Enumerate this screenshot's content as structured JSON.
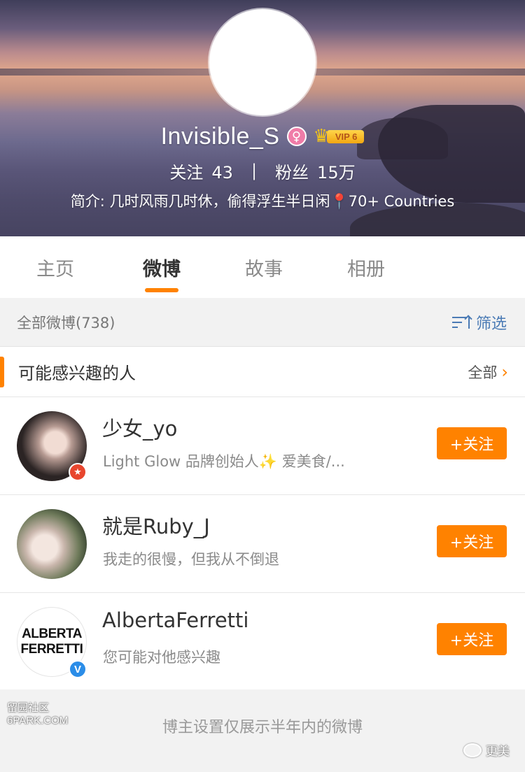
{
  "profile": {
    "username": "Invisible_S",
    "gender_icon": "female-icon",
    "vip_label": "VIP 6",
    "following_label": "关注",
    "following_count": "43",
    "separator": "|",
    "followers_label": "粉丝",
    "followers_count": "15万",
    "bio_text": "简介: 几时风雨几时休，偷得浮生半日闲",
    "bio_extra": "70+ Countries"
  },
  "tabs": [
    {
      "label": "主页",
      "active": false
    },
    {
      "label": "微博",
      "active": true
    },
    {
      "label": "故事",
      "active": false
    },
    {
      "label": "相册",
      "active": false
    }
  ],
  "filter_bar": {
    "count_label": "全部微博(738)",
    "filter_label": "筛选"
  },
  "suggestions": {
    "title": "可能感兴趣的人",
    "see_all_label": "全部",
    "users": [
      {
        "name": "少女_yo",
        "desc": "Light Glow 品牌创始人✨ 爱美食/...",
        "button": "+关注",
        "badge": "star"
      },
      {
        "name": "就是Ruby_J",
        "desc": "我走的很慢，但我从不倒退",
        "button": "+关注",
        "badge": ""
      },
      {
        "name": "AlbertaFerretti",
        "desc": "您可能对他感兴趣",
        "button": "+关注",
        "badge": "V",
        "logo_line1": "ALBERTA",
        "logo_line2": "FERRETTI"
      }
    ]
  },
  "footer": {
    "note": "博主设置仅展示半年内的微博"
  },
  "watermarks": {
    "left_line1": "留园社区",
    "left_line2": "6PARK.COM",
    "right": "更美"
  },
  "colors": {
    "accent": "#ff8200",
    "link": "#4b7bb5",
    "verified": "#2b8de8"
  }
}
